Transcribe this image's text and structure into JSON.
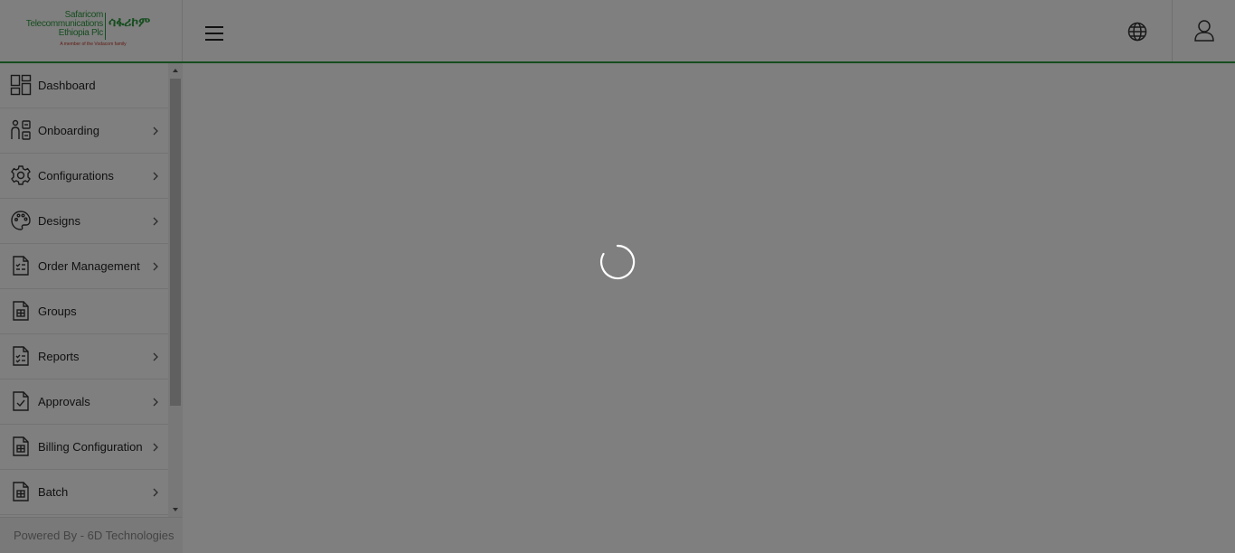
{
  "header": {
    "logo": {
      "line1": "Safaricom",
      "line2": "Telecommunications",
      "line3": "Ethiopia Plc",
      "amharic": "ሳፋሪኮም",
      "tagline": "A member of the Vodacom family"
    },
    "icons": {
      "menu": "hamburger-icon",
      "language": "globe-icon",
      "user": "user-icon"
    }
  },
  "sidebar": {
    "items": [
      {
        "label": "Dashboard",
        "icon": "dashboard-icon",
        "has_submenu": false
      },
      {
        "label": "Onboarding",
        "icon": "onboarding-icon",
        "has_submenu": true
      },
      {
        "label": "Configurations",
        "icon": "gear-icon",
        "has_submenu": true
      },
      {
        "label": "Designs",
        "icon": "palette-icon",
        "has_submenu": true
      },
      {
        "label": "Order Management",
        "icon": "order-document-icon",
        "has_submenu": true
      },
      {
        "label": "Groups",
        "icon": "groups-document-icon",
        "has_submenu": false
      },
      {
        "label": "Reports",
        "icon": "reports-document-icon",
        "has_submenu": true
      },
      {
        "label": "Approvals",
        "icon": "approvals-document-icon",
        "has_submenu": true
      },
      {
        "label": "Billing Configuration",
        "icon": "billing-document-icon",
        "has_submenu": true
      },
      {
        "label": "Batch",
        "icon": "batch-document-icon",
        "has_submenu": true
      }
    ]
  },
  "footer": {
    "text": "Powered By - 6D Technologies"
  },
  "loading": {
    "visible": true,
    "icon": "loading-spinner-icon"
  },
  "colors": {
    "brand_green": "#2c9a3f",
    "overlay": "rgba(0,0,0,0.5)"
  }
}
